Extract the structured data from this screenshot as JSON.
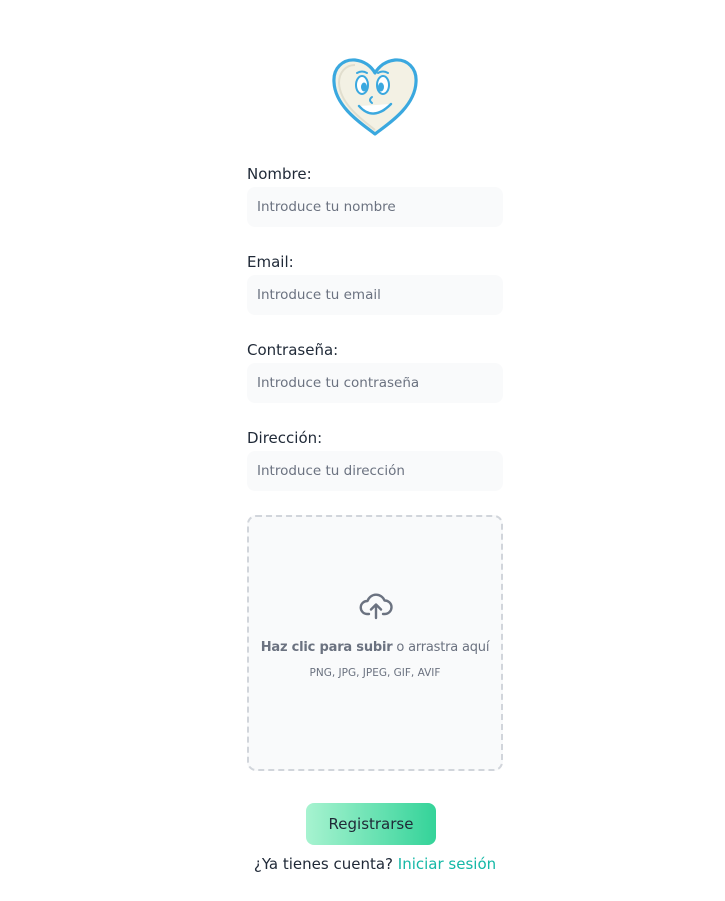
{
  "logo": {
    "icon": "smiling-heart-mascot-icon",
    "colors": {
      "outline": "#3aa8df",
      "fill": "#f3f1e4"
    }
  },
  "form": {
    "name": {
      "label": "Nombre:",
      "placeholder": "Introduce tu nombre",
      "value": ""
    },
    "email": {
      "label": "Email:",
      "placeholder": "Introduce tu email",
      "value": ""
    },
    "password": {
      "label": "Contraseña:",
      "placeholder": "Introduce tu contraseña",
      "value": ""
    },
    "address": {
      "label": "Dirección:",
      "placeholder": "Introduce tu dirección",
      "value": ""
    },
    "upload": {
      "icon": "cloud-upload-icon",
      "cta_bold": "Haz clic para subir",
      "cta_rest": " o arrastra aquí",
      "formats": "PNG, JPG, JPEG, GIF, AVIF"
    },
    "submit_label": "Registrarse",
    "login_prompt": "¿Ya tienes cuenta?",
    "login_link": "Iniciar sesión"
  },
  "colors": {
    "accent": "#14b8a6",
    "button_gradient_start": "#a7f3d0",
    "button_gradient_end": "#34d399",
    "field_background": "#f9fafb",
    "text": "#1f2937",
    "muted_text": "#6b7280"
  }
}
